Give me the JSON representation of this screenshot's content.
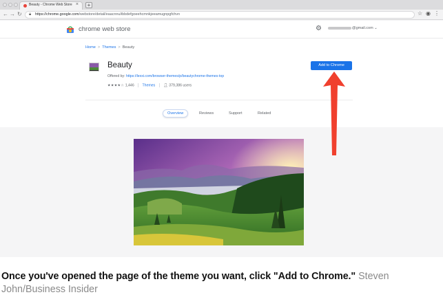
{
  "browser": {
    "tab_title": "Beauty - Chrome Web Store",
    "tab_close": "×",
    "new_tab": "+",
    "url_host": "https://chrome.google.com",
    "url_path": "/webstore/detail/eaacnnu/ibbdefgoeehcmnkjeeamugnpgfchvn"
  },
  "store": {
    "name": "chrome web store",
    "account_suffix": "@gmail.com ⌄",
    "breadcrumb": [
      "Home",
      "Themes",
      "Beauty"
    ],
    "breadcrumb_sep": ">"
  },
  "extension": {
    "title": "Beauty",
    "offered_by_label": "Offered by:",
    "offered_by_link": "https://lexxi.com/browser-themes/p/beautychrome-themes-top",
    "stars": "★★★★☆",
    "rating_count": "1,446",
    "category": "Themes",
    "users": "379,386 users",
    "add_button": "Add to Chrome"
  },
  "tabs": [
    "Overview",
    "Reviews",
    "Support",
    "Related"
  ],
  "caption": {
    "main": "Once you've opened the page of the theme you want, click \"Add to Chrome.\"",
    "credit": "Steven John/Business Insider"
  },
  "colors": {
    "accent_blue": "#1a73e8",
    "arrow_red": "#f0402e"
  }
}
